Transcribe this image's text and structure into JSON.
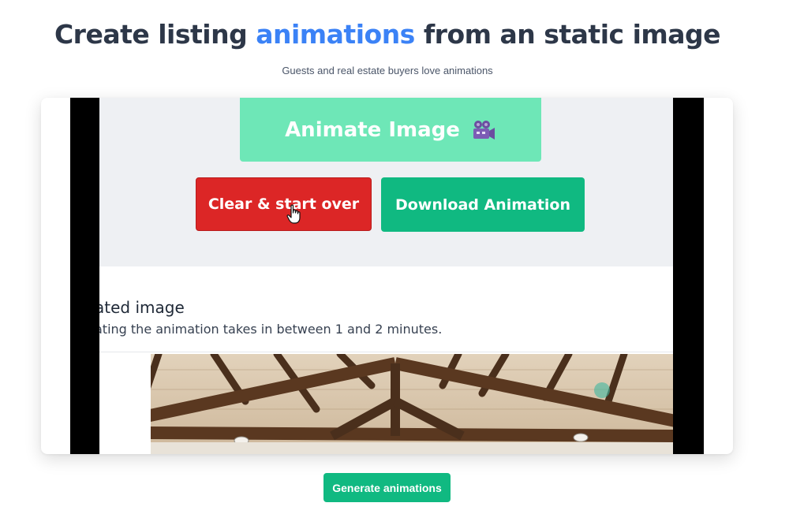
{
  "header": {
    "title_before": "Create listing ",
    "title_accent": "animations",
    "title_after": " from an static image",
    "subtitle": "Guests and real estate buyers love animations"
  },
  "video": {
    "animate_button": "Animate Image",
    "camera_icon": "movie-camera-icon",
    "clear_button": "Clear & start over",
    "download_button": "Download Animation",
    "section_heading": "ated image",
    "section_description": "ating the animation takes in between 1 and 2 minutes."
  },
  "actions": {
    "generate_button": "Generate animations"
  },
  "colors": {
    "accent": "#3b82f6",
    "primary_green": "#10b981",
    "light_green": "#6ee7b7",
    "danger_red": "#dc2626",
    "title_dark": "#2d3748"
  }
}
